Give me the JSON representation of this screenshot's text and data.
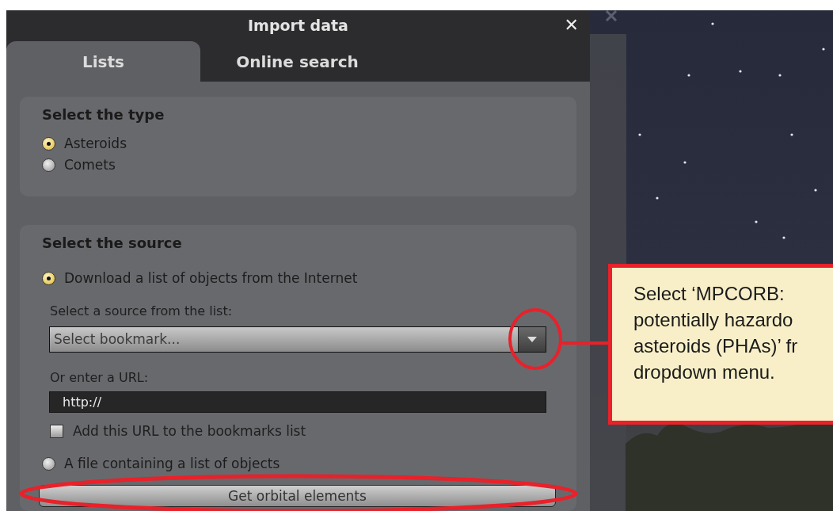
{
  "window": {
    "title": "Import data",
    "close": "✕"
  },
  "tabs": [
    {
      "label": "Lists",
      "selected": true
    },
    {
      "label": "Online search",
      "selected": false
    }
  ],
  "type_group": {
    "title": "Select the type",
    "options": [
      {
        "label": "Asteroids",
        "selected": true
      },
      {
        "label": "Comets",
        "selected": false
      }
    ]
  },
  "source_group": {
    "title": "Select the source",
    "download_option": {
      "label": "Download a list of objects from the Internet",
      "selected": true
    },
    "list_label": "Select a source from the list:",
    "bookmark_dropdown": {
      "placeholder": "Select bookmark..."
    },
    "url_label": "Or enter a URL:",
    "url_field": {
      "value": "http://"
    },
    "bookmark_checkbox": {
      "label": "Add this URL to the bookmarks list",
      "checked": false
    },
    "file_option": {
      "label": "A file containing a list of objects",
      "selected": false
    }
  },
  "submit_button": "Get orbital elements",
  "callout": {
    "lines": [
      "Select ‘MPCORB:",
      "potentially hazardo",
      "asteroids (PHAs)’ fr",
      "dropdown menu."
    ]
  }
}
